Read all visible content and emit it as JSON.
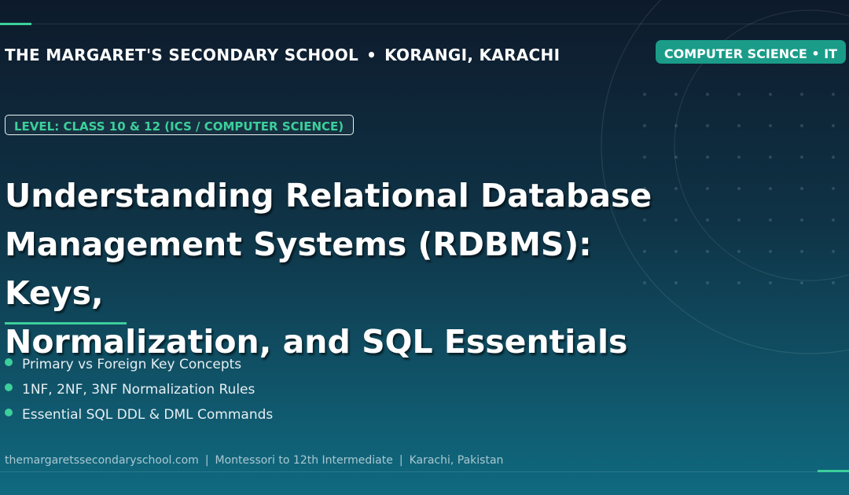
{
  "header": {
    "school_name": "THE MARGARET'S SECONDARY SCHOOL",
    "separator": "•",
    "location": "KORANGI, KARACHI",
    "subject_badge": "COMPUTER SCIENCE • IT"
  },
  "level_badge": "LEVEL: CLASS 10 & 12 (ICS / COMPUTER SCIENCE)",
  "title": {
    "line1": "Understanding Relational Database",
    "line2": "Management Systems (RDBMS): Keys,",
    "line3": "Normalization, and SQL Essentials"
  },
  "points": [
    "Primary vs Foreign Key Concepts",
    "1NF, 2NF, 3NF Normalization Rules",
    "Essential SQL DDL & DML Commands"
  ],
  "footer": {
    "website": "themargaretssecondaryschool.com",
    "separator": "|",
    "range": "Montessori to 12th Intermediate",
    "city": "Karachi, Pakistan"
  },
  "colors": {
    "accent": "#3ccf9b",
    "badge": "#1a9c89",
    "background_top": "#0d1a2b",
    "background_bottom": "#0f6a80"
  }
}
